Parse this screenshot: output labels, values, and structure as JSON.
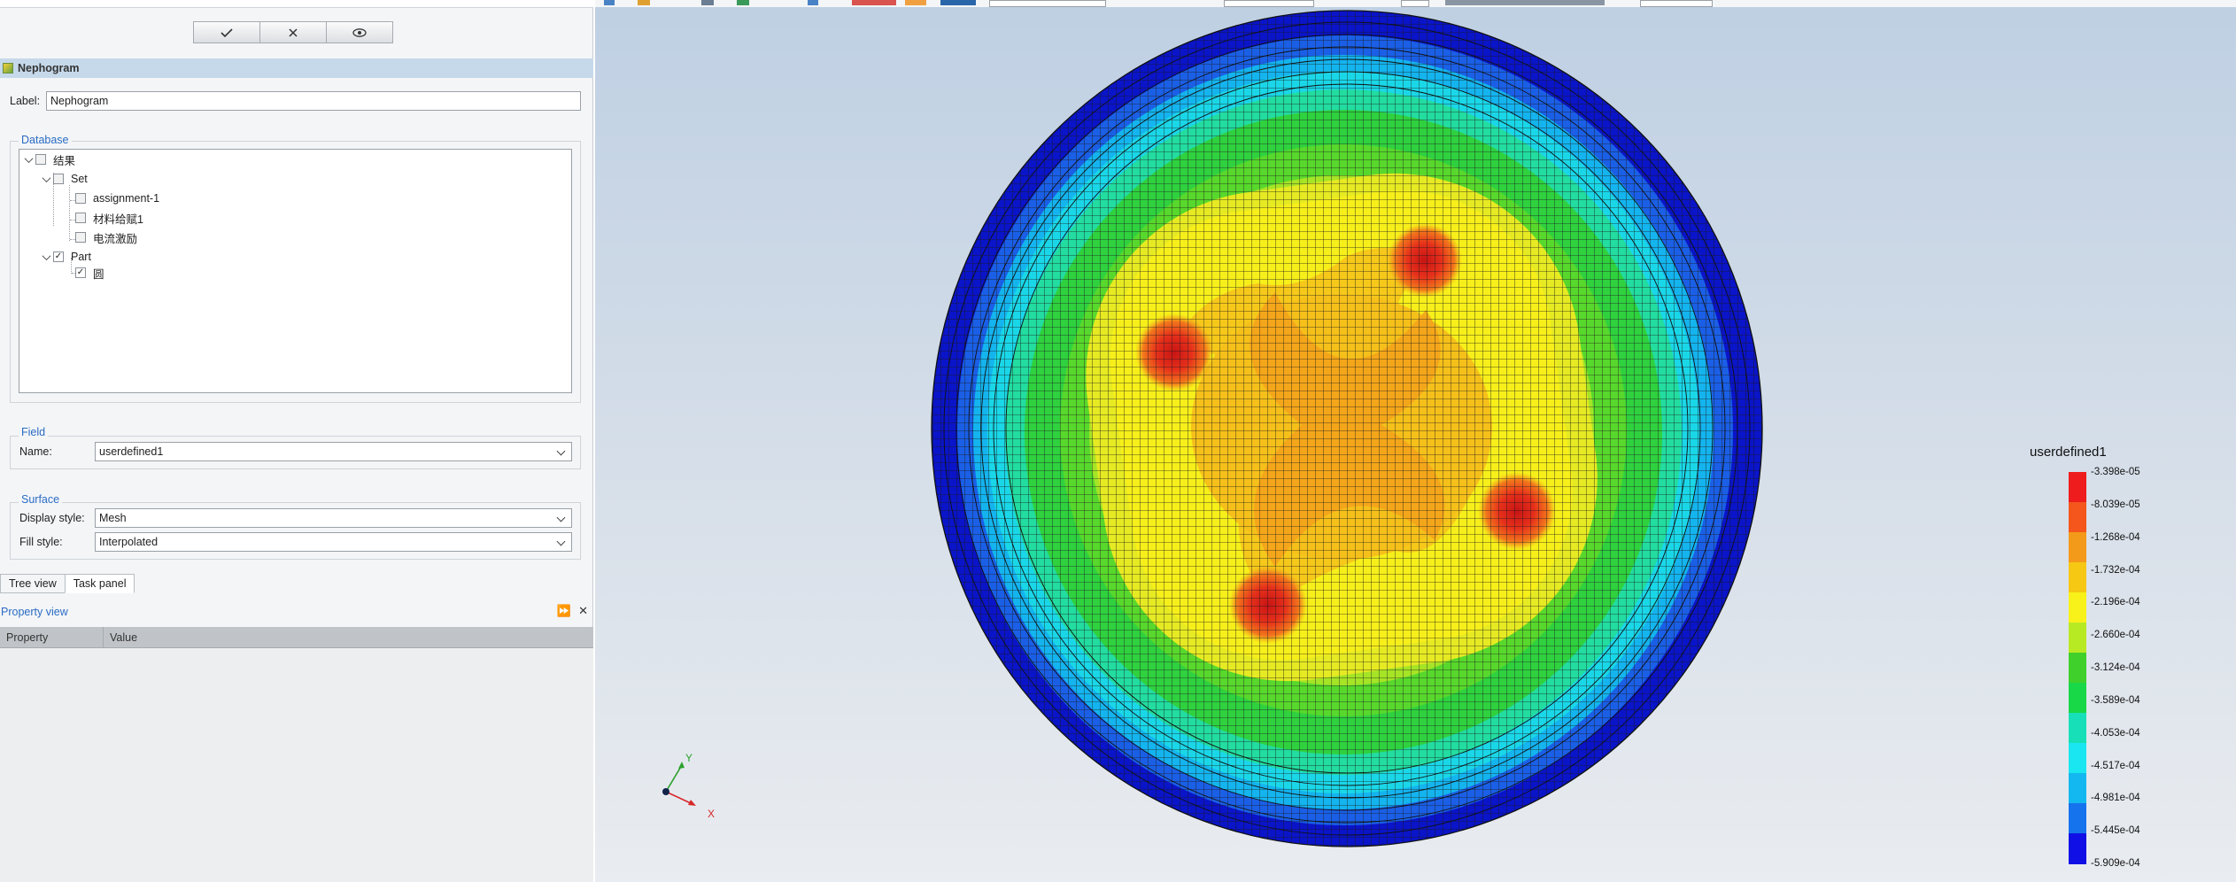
{
  "task_panel": {
    "ok_icon": "check-icon",
    "cancel_icon": "close-icon",
    "preview_icon": "eye-icon",
    "header_title": "Nephogram",
    "label_caption": "Label:",
    "label_value": "Nephogram"
  },
  "database": {
    "title": "Database",
    "tree": {
      "root": "结果",
      "set": "Set",
      "set_items": [
        "assignment-1",
        "材料给赋1",
        "电流激励"
      ],
      "part": "Part",
      "part_items": [
        "圆"
      ]
    }
  },
  "field": {
    "title": "Field",
    "name_caption": "Name:",
    "name_value": "userdefined1"
  },
  "surface": {
    "title": "Surface",
    "display_caption": "Display style:",
    "display_value": "Mesh",
    "fill_caption": "Fill style:",
    "fill_value": "Interpolated"
  },
  "tabs": [
    "Tree view",
    "Task panel"
  ],
  "property_view": {
    "title": "Property view",
    "columns": [
      "Property",
      "Value"
    ]
  },
  "axes": {
    "y": "Y",
    "x": "X"
  },
  "legend": {
    "title": "userdefined1",
    "ticks": [
      "-3.398e-05",
      "-8.039e-05",
      "-1.268e-04",
      "-1.732e-04",
      "-2.196e-04",
      "-2.660e-04",
      "-3.124e-04",
      "-3.589e-04",
      "-4.053e-04",
      "-4.517e-04",
      "-4.981e-04",
      "-5.445e-04",
      "-5.909e-04"
    ],
    "colors": [
      "#ee1c1c",
      "#f4561c",
      "#f49a1a",
      "#f6c814",
      "#f8f21a",
      "#b8ea24",
      "#3fd02b",
      "#18d847",
      "#17e0b8",
      "#19e6f0",
      "#14b8f0",
      "#1573ee",
      "#1010e6"
    ]
  }
}
